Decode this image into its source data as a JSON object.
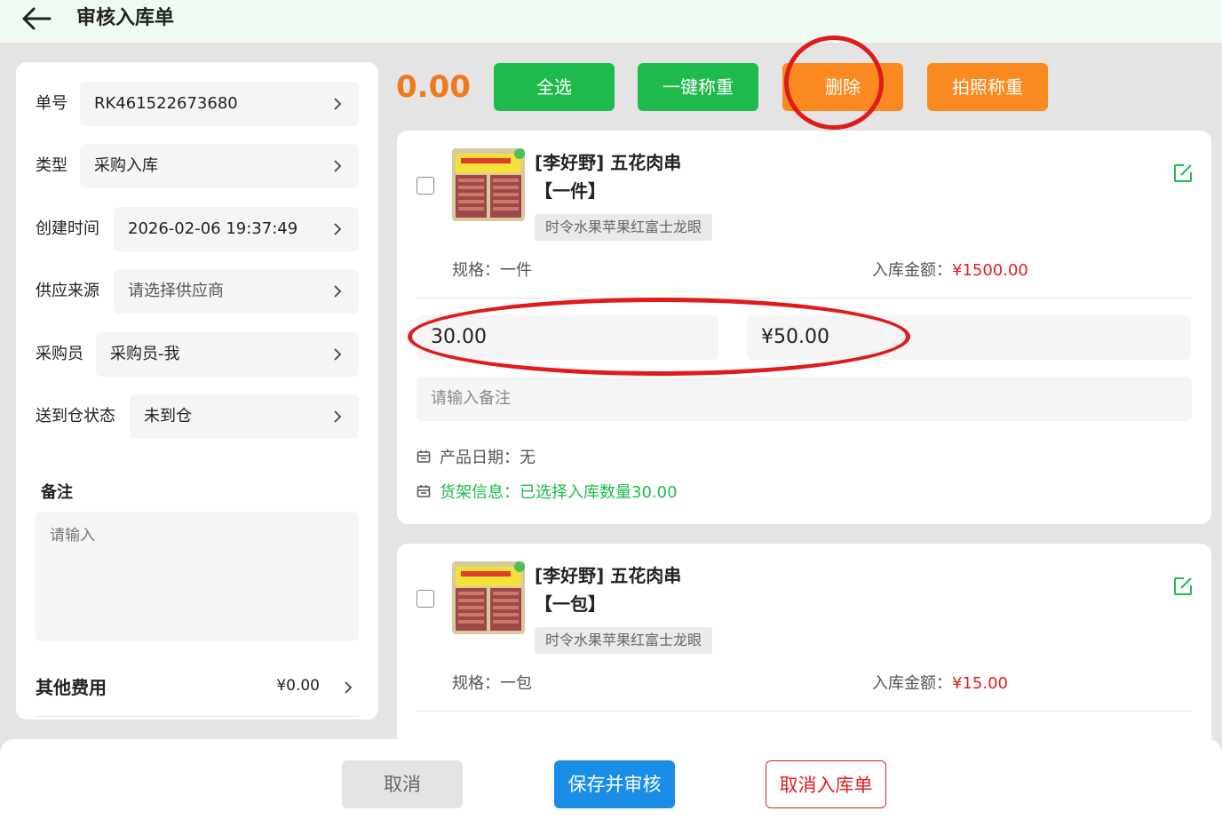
{
  "header": {
    "title": "审核入库单"
  },
  "form": {
    "order_no": {
      "label": "单号",
      "value": "RK461522673680"
    },
    "type": {
      "label": "类型",
      "value": "采购入库"
    },
    "created": {
      "label": "创建时间",
      "value": "2026-02-06 19:37:49"
    },
    "supplier": {
      "label": "供应来源",
      "value": "请选择供应商"
    },
    "buyer": {
      "label": "采购员",
      "value": "采购员-我"
    },
    "warehouse_status": {
      "label": "送到仓状态",
      "value": "未到仓"
    },
    "remark_title": "备注",
    "remark_placeholder": "请输入",
    "other_fee": {
      "label": "其他费用",
      "value": "¥0.00"
    }
  },
  "toolbar": {
    "total": "0.00",
    "select_all": "全选",
    "one_key_weigh": "一键称重",
    "delete": "删除",
    "photo_weigh": "拍照称重"
  },
  "items": [
    {
      "name": "[李好野] 五花肉串【一件】",
      "tag": "时令水果苹果红富士龙眼",
      "spec_label": "规格：",
      "spec": "一件",
      "amount_label": "入库金额：",
      "amount": "¥1500.00",
      "quantity": "30.00",
      "price": "¥50.00",
      "note_placeholder": "请输入备注",
      "date_label": "产品日期：",
      "date": "无",
      "shelf_label": "货架信息：",
      "shelf": "已选择入库数量30.00"
    },
    {
      "name": "[李好野] 五花肉串【一包】",
      "tag": "时令水果苹果红富士龙眼",
      "spec_label": "规格：",
      "spec": "一包",
      "amount_label": "入库金额：",
      "amount": "¥15.00"
    }
  ],
  "footer": {
    "cancel": "取消",
    "save_audit": "保存并审核",
    "void_order": "取消入库单"
  },
  "colors": {
    "green": "#1fba4c",
    "orange": "#fa8a1f",
    "blue": "#1a8ee6",
    "red": "#e02020",
    "annotation": "#e01b1b"
  }
}
